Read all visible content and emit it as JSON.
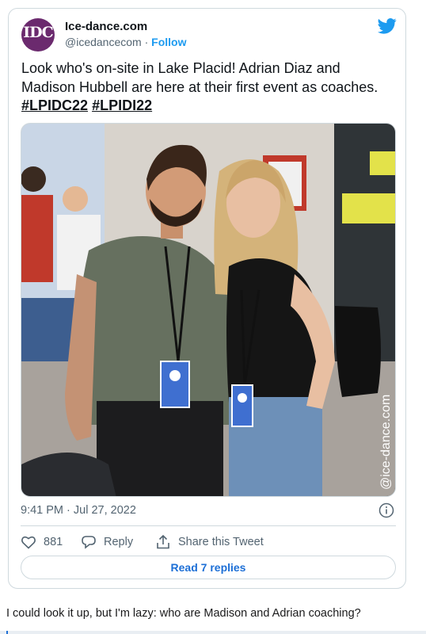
{
  "tweet": {
    "avatar_text": "IDC",
    "display_name": "Ice-dance.com",
    "handle": "@icedancecom",
    "separator": "·",
    "follow_label": "Follow",
    "text": "Look who's on-site in Lake Placid! Adrian Diaz and Madison Hubbell are here at their first event as coaches.",
    "hashtags": [
      "#LPIDC22",
      "#LPIDI22"
    ],
    "image_watermark": "@ice-dance.com",
    "timestamp": "9:41 PM · Jul 27, 2022",
    "like_count": "881",
    "reply_label": "Reply",
    "share_label": "Share this Tweet",
    "read_replies_label": "Read 7 replies"
  },
  "comment": {
    "text": "I could look it up, but I'm lazy: who are Madison and Adrian coaching?"
  },
  "colors": {
    "accent": "#1d9bf0",
    "link_button": "#1d6fd6",
    "muted": "#536471",
    "border": "#cfd9de",
    "avatar_bg": "#6b2a6e"
  },
  "icons": {
    "brand": "twitter-bird-icon",
    "info": "info-icon",
    "like": "heart-icon",
    "reply": "reply-bubble-icon",
    "share": "share-upload-icon"
  }
}
